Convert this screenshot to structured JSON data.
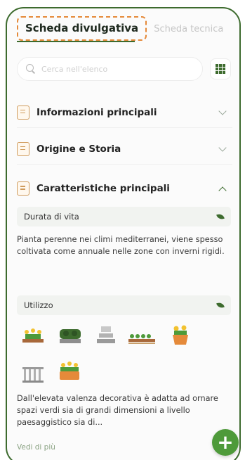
{
  "tabs": {
    "active": "Scheda divulgativa",
    "inactive": "Scheda tecnica"
  },
  "search": {
    "placeholder": "Cerca nell'elenco"
  },
  "sections": [
    {
      "title": "Informazioni principali",
      "icon": "book-icon",
      "expanded": false
    },
    {
      "title": "Origine e Storia",
      "icon": "map-book-icon",
      "expanded": false
    },
    {
      "title": "Caratteristiche principali",
      "icon": "notebook-icon",
      "expanded": true
    }
  ],
  "details": {
    "lifespan_label": "Durata di vita",
    "lifespan_text": "Pianta perenne nei climi mediterranei, viene spesso coltivata come annuale nelle zone con inverni rigidi.",
    "usage_label": "Utilizzo",
    "usage_icons": [
      "flower-bed-icon",
      "hedge-planter-icon",
      "stone-path-icon",
      "border-row-icon",
      "flower-pot-icon",
      "fence-icon",
      "flower-planter-icon"
    ],
    "usage_text": "Dall'elevata valenza decorativa è adatta ad ornare spazi verdi sia di grandi dimensioni a livello paesaggistico sia di...",
    "more_link": "Vedi di più"
  },
  "fab_label": "+",
  "colors": {
    "brand_green": "#3d6b2e",
    "accent_orange": "#e58a3a",
    "fab_green": "#4e9a3a"
  }
}
